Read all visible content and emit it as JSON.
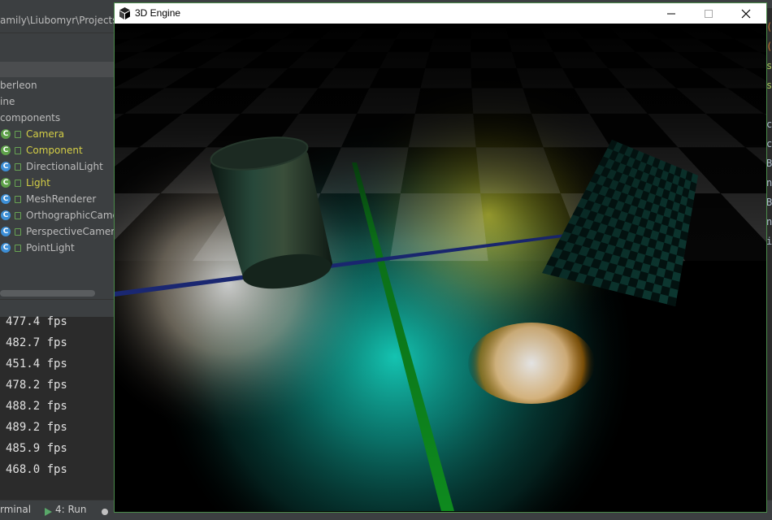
{
  "ide": {
    "path": "amily\\Liubomyr\\Projects\\J",
    "tree": [
      {
        "label": "berleon",
        "icon": "",
        "highlight": false
      },
      {
        "label": "ine",
        "icon": "",
        "highlight": false
      },
      {
        "label": "components",
        "icon": "",
        "highlight": false
      },
      {
        "label": "Camera",
        "icon": "class-icon",
        "highlight": true
      },
      {
        "label": "Component",
        "icon": "class-icon",
        "highlight": true
      },
      {
        "label": "DirectionalLight",
        "icon": "class-icon",
        "highlight": false
      },
      {
        "label": "Light",
        "icon": "class-icon",
        "highlight": true
      },
      {
        "label": "MeshRenderer",
        "icon": "class-icon",
        "highlight": false
      },
      {
        "label": "OrthographicCamer",
        "icon": "class-icon",
        "highlight": false
      },
      {
        "label": "PerspectiveCamera",
        "icon": "class-icon",
        "highlight": false
      },
      {
        "label": "PointLight",
        "icon": "class-icon",
        "highlight": false
      }
    ],
    "console_lines": [
      "477.4 fps",
      "482.7 fps",
      "451.4 fps",
      "478.2 fps",
      "488.2 fps",
      "489.2 fps",
      "485.9 fps",
      "468.0 fps"
    ],
    "bottom_tools": {
      "terminal": "rminal",
      "run": "4: Run"
    },
    "code_fragments": [
      "(s",
      "(s",
      "sy",
      "sy",
      "c",
      "c",
      "B",
      "n",
      "B",
      "n",
      "i"
    ]
  },
  "engine_window": {
    "title": "3D Engine",
    "minimize_label": "—",
    "maximize_label": "☐",
    "close_label": "✕"
  },
  "colors": {
    "highlight_text": "#d4ce46",
    "titlebar_bg": "#ffffff",
    "window_border": "#4a8b4a",
    "ide_bg": "#2b2b2b",
    "panel_bg": "#3c3f41"
  }
}
